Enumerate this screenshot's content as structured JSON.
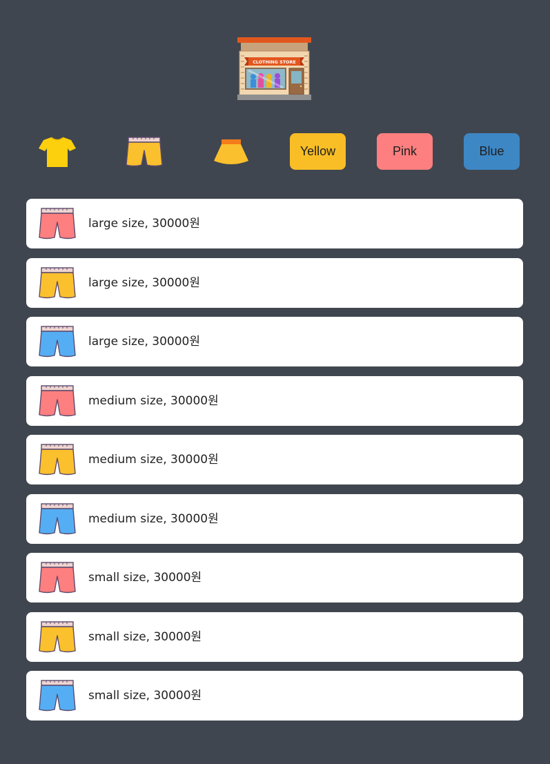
{
  "header": {
    "logo_icon": "clothing-store-icon",
    "logo_text": "CLOTHING STORE"
  },
  "filters": {
    "type_icons": [
      "tshirt-icon",
      "pants-icon",
      "skirt-icon"
    ],
    "color_buttons": [
      {
        "label": "Yellow",
        "color": "#f9be26"
      },
      {
        "label": "Pink",
        "color": "#fd7f7f"
      },
      {
        "label": "Blue",
        "color": "#3d87c5"
      }
    ]
  },
  "products": [
    {
      "icon": "pants-icon",
      "color": "pink",
      "text": "large size, 30000원"
    },
    {
      "icon": "pants-icon",
      "color": "yellow",
      "text": "large size, 30000원"
    },
    {
      "icon": "pants-icon",
      "color": "blue",
      "text": "large size, 30000원"
    },
    {
      "icon": "pants-icon",
      "color": "pink",
      "text": "medium size, 30000원"
    },
    {
      "icon": "pants-icon",
      "color": "yellow",
      "text": "medium size, 30000원"
    },
    {
      "icon": "pants-icon",
      "color": "blue",
      "text": "medium size, 30000원"
    },
    {
      "icon": "pants-icon",
      "color": "pink",
      "text": "small size, 30000원"
    },
    {
      "icon": "pants-icon",
      "color": "yellow",
      "text": "small size, 30000원"
    },
    {
      "icon": "pants-icon",
      "color": "blue",
      "text": "small size, 30000원"
    }
  ],
  "colors": {
    "background": "#40464f",
    "pink_item": "#fd7f7f",
    "yellow_item": "#fbc02d",
    "blue_item": "#55aef4",
    "tshirt": "#fdd00e"
  }
}
